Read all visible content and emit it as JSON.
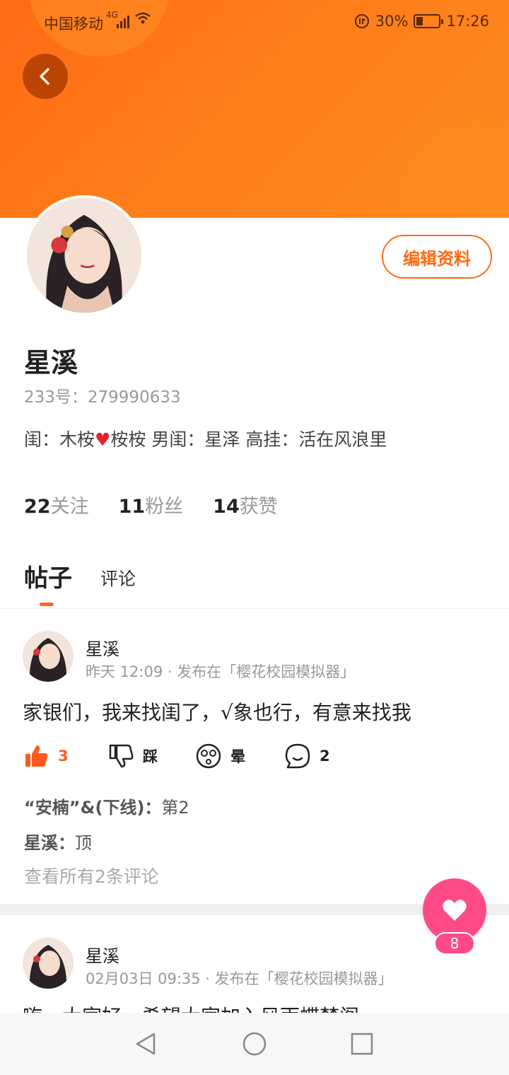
{
  "status_bar": {
    "carrier": "中国移动",
    "network": "4G",
    "battery": "30%",
    "battery_level": 0.3,
    "time": "17:26"
  },
  "profile": {
    "edit_label": "编辑资料",
    "name": "星溪",
    "id_text": "233号：279990633",
    "bio_part1": "闺：木桉",
    "bio_part2": "桉桉   男闺：星泽   高挂：活在风浪里",
    "stats": [
      {
        "num": "22",
        "label": "关注"
      },
      {
        "num": "11",
        "label": "粉丝"
      },
      {
        "num": "14",
        "label": "获赞"
      }
    ]
  },
  "tabs": {
    "posts": "帖子",
    "comments": "评论"
  },
  "posts": [
    {
      "author": "星溪",
      "meta": "昨天 12:09 · 发布在「樱花校园模拟器」",
      "text": "家银们，我来找闺了，√象也行，有意来找我",
      "like_count": "3",
      "dislike_label": "踩",
      "dizzy_label": "晕",
      "comment_count": "2",
      "comments": [
        {
          "user": "“安楠”&(下线)：",
          "text": "第2"
        },
        {
          "user": "星溪：",
          "text": "顶"
        }
      ],
      "see_all": "查看所有2条评论"
    },
    {
      "author": "星溪",
      "meta": "02月03日 09:35 · 发布在「樱花校园模拟器」",
      "text": "嗨，大家好，希望大家加入风雨蝶梦阁"
    }
  ],
  "like_fab": {
    "count": "8"
  },
  "colors": {
    "accent": "#ff6a13",
    "pink": "#ff4a8a",
    "like": "#ff5a1a"
  }
}
